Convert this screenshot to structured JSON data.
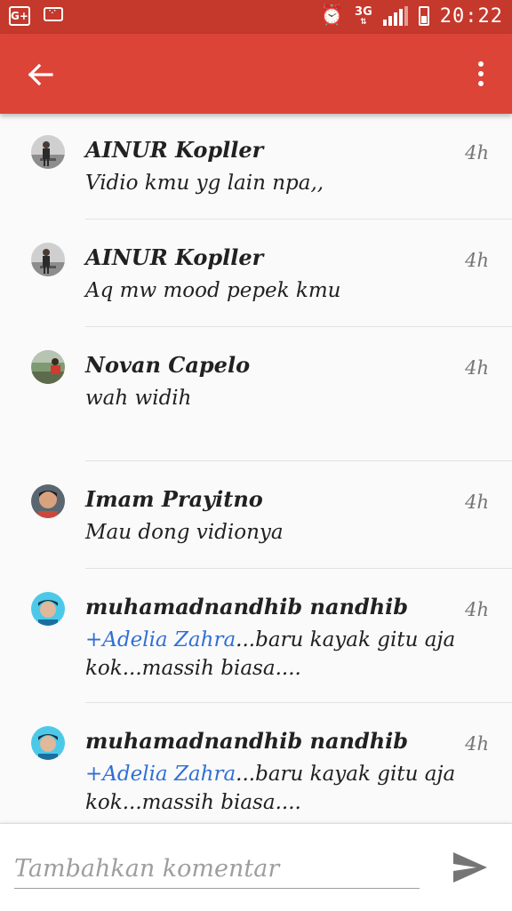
{
  "status_bar": {
    "gplus_label": "G+",
    "network": "3G",
    "time": "20:22",
    "icons": [
      "google-plus-icon",
      "bbm-icon",
      "alarm-icon",
      "signal-icon",
      "battery-icon"
    ]
  },
  "app_bar": {
    "color": "#dc4437",
    "back_icon": "arrow-back-icon",
    "menu_icon": "more-vert-icon"
  },
  "comments": [
    {
      "author": "AINUR Kopller",
      "time": "4h",
      "mention": "",
      "text": "Vidio kmu yg lain npa,,"
    },
    {
      "author": "AINUR Kopller",
      "time": "4h",
      "mention": "",
      "text": "Aq mw mood pepek kmu"
    },
    {
      "author": "Novan Capelo",
      "time": "4h",
      "mention": "",
      "text": "wah widih"
    },
    {
      "author": "Imam Prayitno",
      "time": "4h",
      "mention": "",
      "text": "Mau dong vidionya"
    },
    {
      "author": "muhamadnandhib nandhib",
      "time": "4h",
      "mention": "+Adelia Zahra",
      "text": "...baru kayak gitu aja kok...massih biasa...."
    },
    {
      "author": "muhamadnandhib nandhib",
      "time": "4h",
      "mention": "+Adelia Zahra",
      "text": "...baru kayak gitu aja kok...massih biasa...."
    }
  ],
  "composer": {
    "placeholder": "Tambahkan komentar",
    "value": "",
    "send_icon": "send-icon"
  },
  "colors": {
    "status_bar": "#c5382c",
    "app_bar": "#dc4437",
    "mention": "#2f6fd6"
  }
}
